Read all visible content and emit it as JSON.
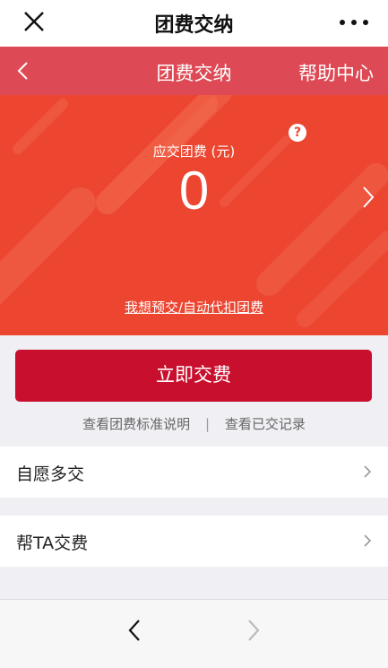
{
  "topbar": {
    "title": "团费交纳"
  },
  "header": {
    "title": "团费交纳",
    "help": "帮助中心"
  },
  "hero": {
    "help_mark": "?",
    "due_label": "应交团费 (元)",
    "amount": "0",
    "prepay_link": "我想预交/自动代扣团费"
  },
  "pay": {
    "button": "立即交费",
    "link_standard": "查看团费标准说明",
    "separator": "|",
    "link_records": "查看已交记录"
  },
  "options": [
    {
      "label": "自愿多交"
    },
    {
      "label": "帮TA交费"
    }
  ],
  "colors": {
    "header_bg": "#dd4a55",
    "hero_bg": "#ec4631",
    "pay_button": "#c8102e"
  },
  "icons": {
    "close": "close-icon",
    "more": "more-icon",
    "back": "chevron-left-icon",
    "forward": "chevron-right-icon"
  }
}
